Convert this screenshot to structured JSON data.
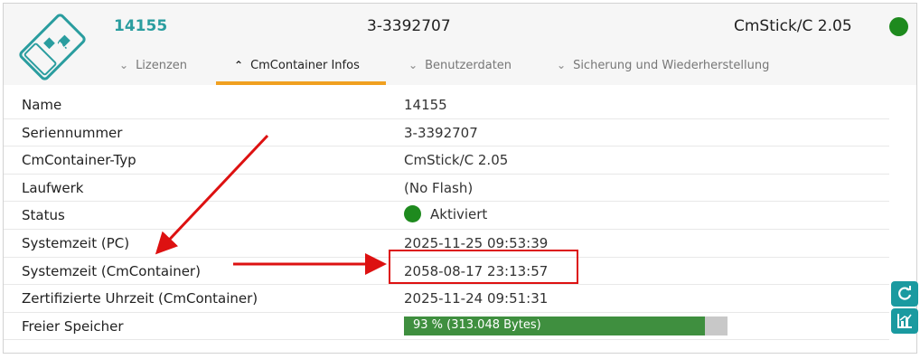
{
  "header": {
    "container_name": "14155",
    "serial": "3-3392707",
    "container_type": "CmStick/C 2.05",
    "status_color": "#1e8a1e"
  },
  "tabs": [
    {
      "label": "Lizenzen",
      "active": false
    },
    {
      "label": "CmContainer Infos",
      "active": true
    },
    {
      "label": "Benutzerdaten",
      "active": false
    },
    {
      "label": "Sicherung und Wiederherstellung",
      "active": false
    }
  ],
  "info": {
    "name": {
      "label": "Name",
      "value": "14155"
    },
    "serial": {
      "label": "Seriennummer",
      "value": "3-3392707"
    },
    "type": {
      "label": "CmContainer-Typ",
      "value": "CmStick/C 2.05"
    },
    "drive": {
      "label": "Laufwerk",
      "value": "(No Flash)"
    },
    "status": {
      "label": "Status",
      "value": "Aktiviert"
    },
    "system_time_pc": {
      "label": "Systemzeit (PC)",
      "value": "2025-11-25 09:53:39"
    },
    "system_time_container": {
      "label": "Systemzeit (CmContainer)",
      "value": "2058-08-17 23:13:57"
    },
    "certified_time": {
      "label": "Zertifizierte Uhrzeit (CmContainer)",
      "value": "2025-11-24 09:51:31"
    },
    "free_memory": {
      "label": "Freier Speicher",
      "value": "93 % (313.048 Bytes)",
      "percent": 93
    }
  },
  "colors": {
    "accent": "#2a9d9f",
    "tab_underline": "#f0a020",
    "progress_fill": "#3f8f3f",
    "annotation": "#d11"
  },
  "icons": [
    "cmstick-logo-icon",
    "chevron-down-icon",
    "chevron-up-icon",
    "refresh-icon",
    "chart-icon"
  ]
}
